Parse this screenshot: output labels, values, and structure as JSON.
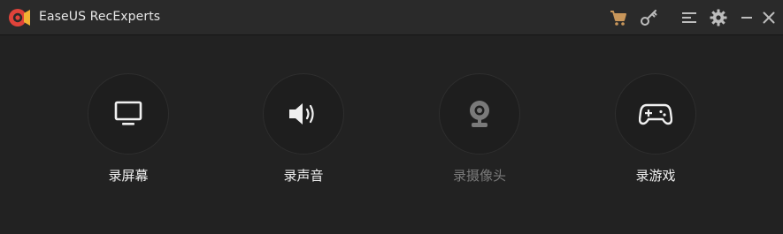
{
  "app": {
    "title": "EaseUS RecExperts"
  },
  "colors": {
    "background": "#222222",
    "titlebar": "#2a2a2a",
    "accent_logo": "#e0433a",
    "cart_icon": "#c8965a",
    "text": "#f0f0f0",
    "disabled_text": "#7a7a7a"
  },
  "titlebar_icons": [
    "cart-icon",
    "key-icon",
    "menu-icon",
    "gear-icon",
    "minimize-icon",
    "close-icon"
  ],
  "modes": [
    {
      "id": "screen",
      "label": "录屏幕",
      "icon": "monitor-icon",
      "enabled": true
    },
    {
      "id": "audio",
      "label": "录声音",
      "icon": "speaker-icon",
      "enabled": true
    },
    {
      "id": "webcam",
      "label": "录摄像头",
      "icon": "webcam-icon",
      "enabled": false
    },
    {
      "id": "game",
      "label": "录游戏",
      "icon": "gamepad-icon",
      "enabled": true
    }
  ]
}
